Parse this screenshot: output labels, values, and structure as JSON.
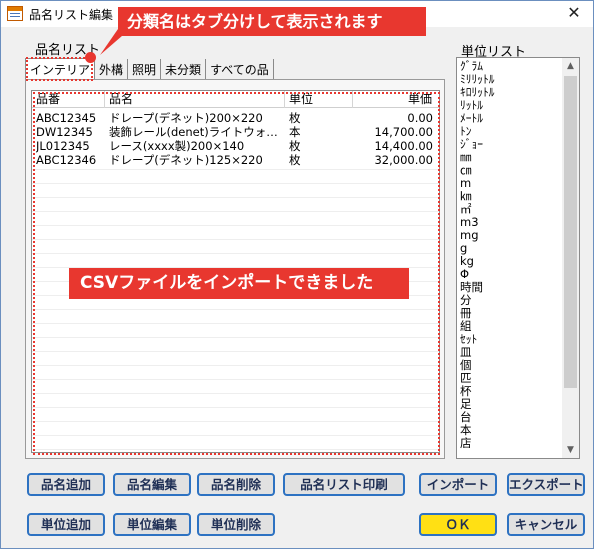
{
  "window": {
    "title": "品名リスト編集",
    "close_glyph": "✕"
  },
  "callouts": {
    "tabs_note": "分類名はタブ分けして表示されます",
    "csv_note": "CSVファイルをインポートできました"
  },
  "item_list": {
    "label": "品名リスト",
    "tabs": [
      {
        "label": "インテリア",
        "active": true
      },
      {
        "label": "外構",
        "active": false
      },
      {
        "label": "照明",
        "active": false
      },
      {
        "label": "未分類",
        "active": false
      },
      {
        "label": "すべての品",
        "active": false
      }
    ],
    "columns": [
      "品番",
      "品名",
      "単位",
      "単価"
    ],
    "rows": [
      {
        "code": "ABC12345",
        "name": "ドレープ(デネット)200×220",
        "unit": "枚",
        "price": "0.00"
      },
      {
        "code": "DW12345",
        "name": "装飾レール(denet)ライトウォ…",
        "unit": "本",
        "price": "14,700.00"
      },
      {
        "code": "JL012345",
        "name": "レース(xxxx製)200×140",
        "unit": "枚",
        "price": "14,400.00"
      },
      {
        "code": "ABC12346",
        "name": "ドレープ(デネット)125×220",
        "unit": "枚",
        "price": "32,000.00"
      }
    ]
  },
  "unit_list": {
    "label": "単位リスト",
    "items": [
      "ｸﾞﾗﾑ",
      "ﾐﾘﾘｯﾄﾙ",
      "ｷﾛﾘｯﾄﾙ",
      "ﾘｯﾄﾙ",
      "ﾒｰﾄﾙ",
      "ﾄﾝ",
      "ｼﾞｮｰ",
      "㎜",
      "㎝",
      "m",
      "㎞",
      "㎡",
      "m3",
      "mg",
      "g",
      "kg",
      "Φ",
      "時間",
      "分",
      "冊",
      "組",
      "ｾｯﾄ",
      "皿",
      "個",
      "匹",
      "杯",
      "足",
      "台",
      "本",
      "店"
    ]
  },
  "buttons": {
    "add_item": "品名追加",
    "edit_item": "品名編集",
    "delete_item": "品名削除",
    "print_list": "品名リスト印刷",
    "import": "インポート",
    "export": "エクスポート",
    "add_unit": "単位追加",
    "edit_unit": "単位編集",
    "delete_unit": "単位削除",
    "ok": "ＯＫ",
    "cancel": "キャンセル"
  }
}
